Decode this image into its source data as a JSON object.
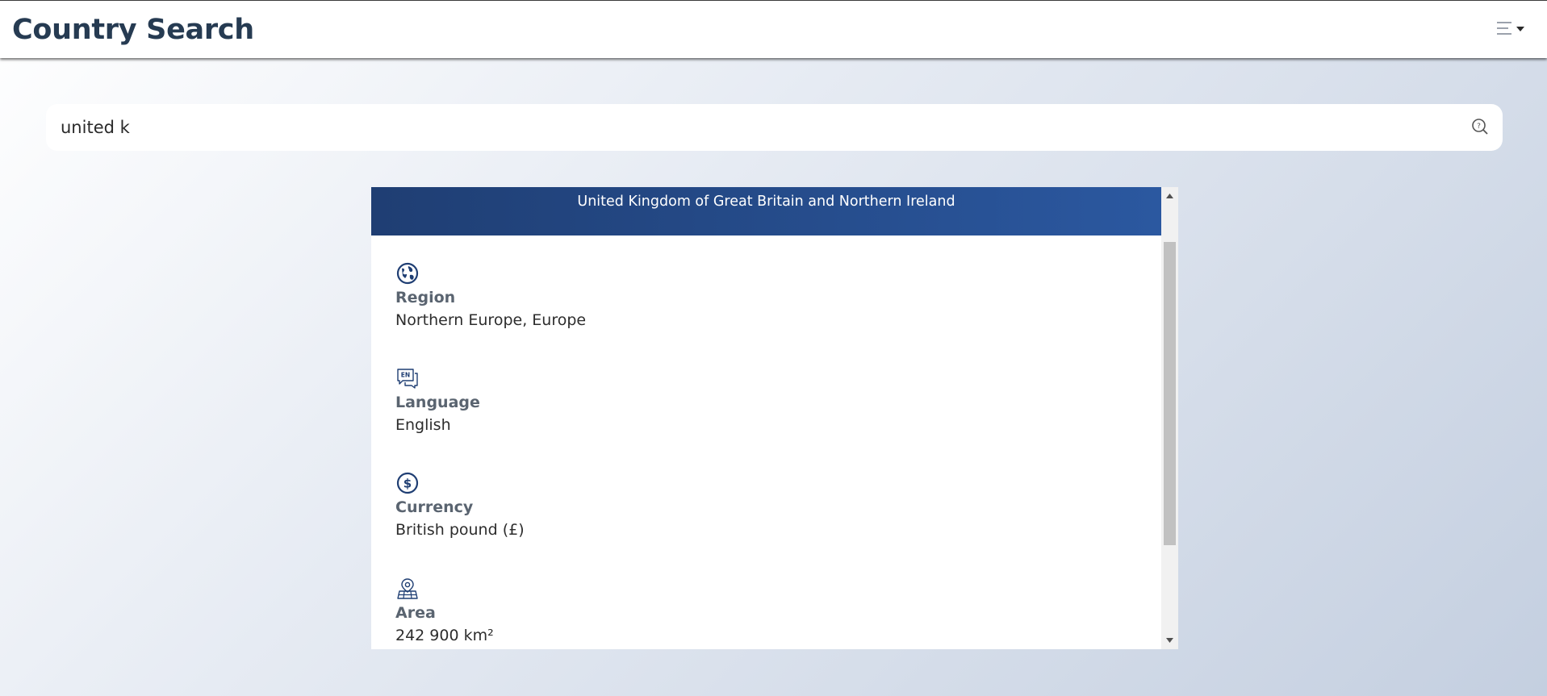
{
  "header": {
    "title": "Country Search",
    "menu_icon": "hamburger-menu-icon"
  },
  "search": {
    "value": "united k",
    "icon": "search-icon"
  },
  "result": {
    "country_name": "United Kingdom of Great Britain and Northern Ireland",
    "header_colors": [
      "#1f3e73",
      "#2b58a0"
    ],
    "fields": [
      {
        "icon": "globe-icon",
        "label": "Region",
        "value": "Northern Europe, Europe"
      },
      {
        "icon": "language-en-icon",
        "label": "Language",
        "value": "English"
      },
      {
        "icon": "currency-dollar-icon",
        "label": "Currency",
        "value": "British pound (£)"
      },
      {
        "icon": "map-pin-area-icon",
        "label": "Area",
        "value": "242 900 km²"
      }
    ]
  },
  "colors": {
    "title": "#263b52",
    "accent": "#1f3e73"
  }
}
